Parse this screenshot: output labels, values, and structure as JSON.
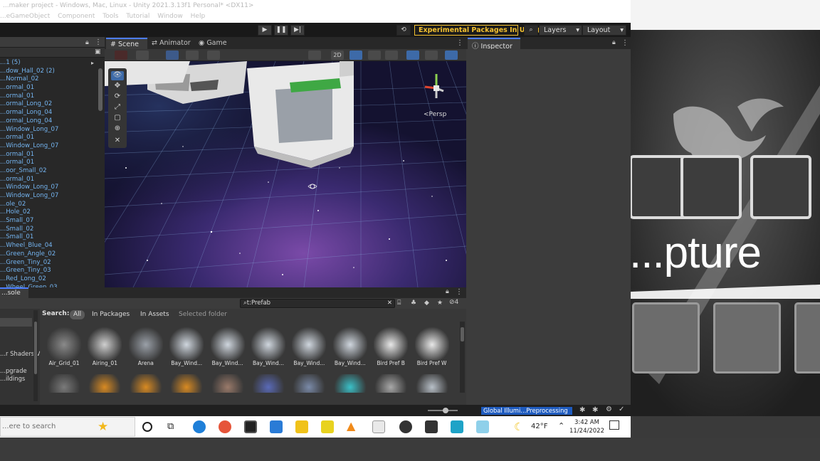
{
  "window": {
    "title": "...maker project - Windows, Mac, Linux - Unity 2021.3.13f1 Personal* <DX11>"
  },
  "menu": [
    "...eGameObject",
    "Component",
    "Tools",
    "Tutorial",
    "Window",
    "Help"
  ],
  "toolbar": {
    "experimental_label": "Experimental Packages In Use ▼",
    "layers_label": "Layers",
    "layout_label": "Layout"
  },
  "hierarchy": {
    "items": [
      "...1 (5)",
      "...dow_Hall_02 (2)",
      "...Normal_02",
      "...ormal_01",
      "...ormal_01",
      "...ormal_Long_02",
      "...ormal_Long_04",
      "...ormal_Long_04",
      "...Window_Long_07",
      "...ormal_01",
      "...Window_Long_07",
      "...ormal_01",
      "...ormal_01",
      "...oor_Small_02",
      "...ormal_01",
      "...Window_Long_07",
      "...Window_Long_07",
      "...ole_02",
      "...Hole_02",
      "...Small_07",
      "...Small_02",
      "...Small_01",
      "...Wheel_Blue_04",
      "...Green_Angle_02",
      "...Green_Tiny_02",
      "...Green_Tiny_03",
      "...Red_Long_02",
      "...Wheel_Green_03"
    ]
  },
  "scene": {
    "tabs": [
      "Scene",
      "Animator",
      "Game"
    ],
    "toolbar_2d": "2D",
    "persp_label": "<Persp"
  },
  "inspector": {
    "tab": "Inspector"
  },
  "project": {
    "tab": "...sole",
    "search_value": "t:Prefab",
    "filter_count": "4",
    "search_label": "Search:",
    "filters": [
      "All",
      "In Packages",
      "In Assets",
      "Selected folder"
    ],
    "folders": [
      "...r Shaders V",
      "...pgrade",
      "...ildings"
    ],
    "assets": [
      "Air_Grid_01",
      "Airing_01",
      "Arena",
      "Bay_Wind...",
      "Bay_Wind...",
      "Bay_Wind...",
      "Bay_Wind...",
      "Bay_Wind...",
      "Bird Pref B",
      "Bird Pref W"
    ]
  },
  "status": {
    "progress_label": "Global Illumi...Preprocessing"
  },
  "taskbar": {
    "search_placeholder": "...ere to search",
    "weather": "42°F",
    "time": "3:42 AM",
    "date": "11/24/2022"
  },
  "backdrop": {
    "caption": "...pture"
  },
  "colors": {
    "accent_yellow": "#f5c230",
    "unity_blue": "#4c7dff",
    "progress_blue": "#1e5bbf",
    "hierarchy_blue": "#74b4f0"
  }
}
